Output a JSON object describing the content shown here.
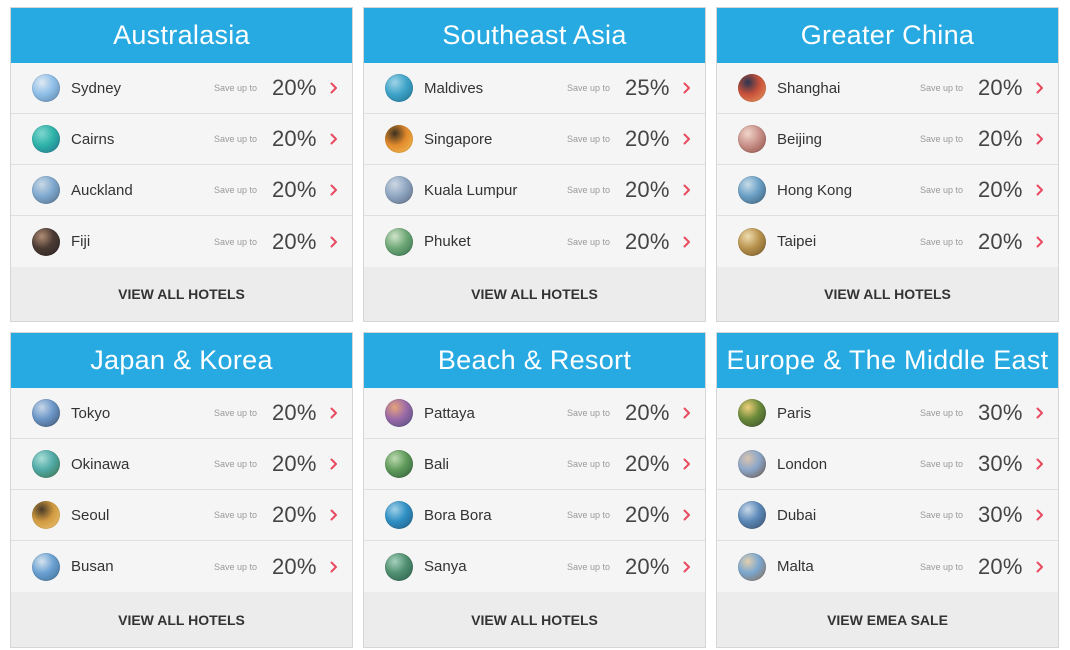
{
  "save_label": "Save up to",
  "accent_color": "#27a9e1",
  "chevron_color": "#e84a5f",
  "regions": [
    {
      "title": "Australasia",
      "footer": "VIEW ALL HOTELS",
      "cities": [
        {
          "name": "Sydney",
          "discount": "20%",
          "thumb": [
            "#8fbfe8",
            "#dfe9f2",
            "#5a7fa3"
          ]
        },
        {
          "name": "Cairns",
          "discount": "20%",
          "thumb": [
            "#2fb3a8",
            "#7fd6d0",
            "#1f6e8a"
          ]
        },
        {
          "name": "Auckland",
          "discount": "20%",
          "thumb": [
            "#7fa9cf",
            "#c9d9e6",
            "#4e6a85"
          ]
        },
        {
          "name": "Fiji",
          "discount": "20%",
          "thumb": [
            "#4a3a33",
            "#b08d74",
            "#2b2220"
          ]
        }
      ]
    },
    {
      "title": "Southeast Asia",
      "footer": "VIEW ALL HOTELS",
      "cities": [
        {
          "name": "Maldives",
          "discount": "25%",
          "thumb": [
            "#3fa4c9",
            "#9fd3e6",
            "#1d6f8f"
          ]
        },
        {
          "name": "Singapore",
          "discount": "20%",
          "thumb": [
            "#e28a2b",
            "#3a3020",
            "#f2c25a"
          ]
        },
        {
          "name": "Kuala Lumpur",
          "discount": "20%",
          "thumb": [
            "#8fa6c2",
            "#cdd7e3",
            "#59667a"
          ]
        },
        {
          "name": "Phuket",
          "discount": "20%",
          "thumb": [
            "#6fa877",
            "#cfe3c8",
            "#2f6a4a"
          ]
        }
      ]
    },
    {
      "title": "Greater China",
      "footer": "VIEW ALL HOTELS",
      "cities": [
        {
          "name": "Shanghai",
          "discount": "20%",
          "thumb": [
            "#c8503a",
            "#2a3550",
            "#e9a060"
          ]
        },
        {
          "name": "Beijing",
          "discount": "20%",
          "thumb": [
            "#c9928a",
            "#f1d6c9",
            "#8a4a42"
          ]
        },
        {
          "name": "Hong Kong",
          "discount": "20%",
          "thumb": [
            "#6a9fc5",
            "#c7dce8",
            "#3a5a73"
          ]
        },
        {
          "name": "Taipei",
          "discount": "20%",
          "thumb": [
            "#b8934e",
            "#efdcae",
            "#6e5326"
          ]
        }
      ]
    },
    {
      "title": "Japan & Korea",
      "footer": "VIEW ALL HOTELS",
      "cities": [
        {
          "name": "Tokyo",
          "discount": "20%",
          "thumb": [
            "#6b96c7",
            "#c6d6e8",
            "#3f4f6a"
          ]
        },
        {
          "name": "Okinawa",
          "discount": "20%",
          "thumb": [
            "#4fa9a5",
            "#a9ddd7",
            "#3b6e47"
          ]
        },
        {
          "name": "Seoul",
          "discount": "20%",
          "thumb": [
            "#d09a40",
            "#463828",
            "#f0c878"
          ]
        },
        {
          "name": "Busan",
          "discount": "20%",
          "thumb": [
            "#6aa0d2",
            "#d6e4ef",
            "#3c6a8c"
          ]
        }
      ]
    },
    {
      "title": "Beach & Resort",
      "footer": "VIEW ALL HOTELS",
      "cities": [
        {
          "name": "Pattaya",
          "discount": "20%",
          "thumb": [
            "#9a6aa8",
            "#e6a37a",
            "#4b4a7a"
          ]
        },
        {
          "name": "Bali",
          "discount": "20%",
          "thumb": [
            "#5f9a5a",
            "#bcd9b0",
            "#2f5a3a"
          ]
        },
        {
          "name": "Bora Bora",
          "discount": "20%",
          "thumb": [
            "#2f8fc4",
            "#9fd0e8",
            "#1f5a7f"
          ]
        },
        {
          "name": "Sanya",
          "discount": "20%",
          "thumb": [
            "#4f8f6f",
            "#a5d0bd",
            "#2b5a4a"
          ]
        }
      ]
    },
    {
      "title": "Europe & The Middle East",
      "footer": "VIEW EMEA SALE",
      "cities": [
        {
          "name": "Paris",
          "discount": "30%",
          "thumb": [
            "#6a8a3a",
            "#f0d07a",
            "#3a4a2a"
          ]
        },
        {
          "name": "London",
          "discount": "30%",
          "thumb": [
            "#8aa6c9",
            "#d9c3b0",
            "#6a5040"
          ]
        },
        {
          "name": "Dubai",
          "discount": "30%",
          "thumb": [
            "#5a88b8",
            "#c8d8e8",
            "#3a4c66"
          ]
        },
        {
          "name": "Malta",
          "discount": "20%",
          "thumb": [
            "#7aa6d0",
            "#e1d0b0",
            "#8a6a4a"
          ]
        }
      ]
    }
  ]
}
